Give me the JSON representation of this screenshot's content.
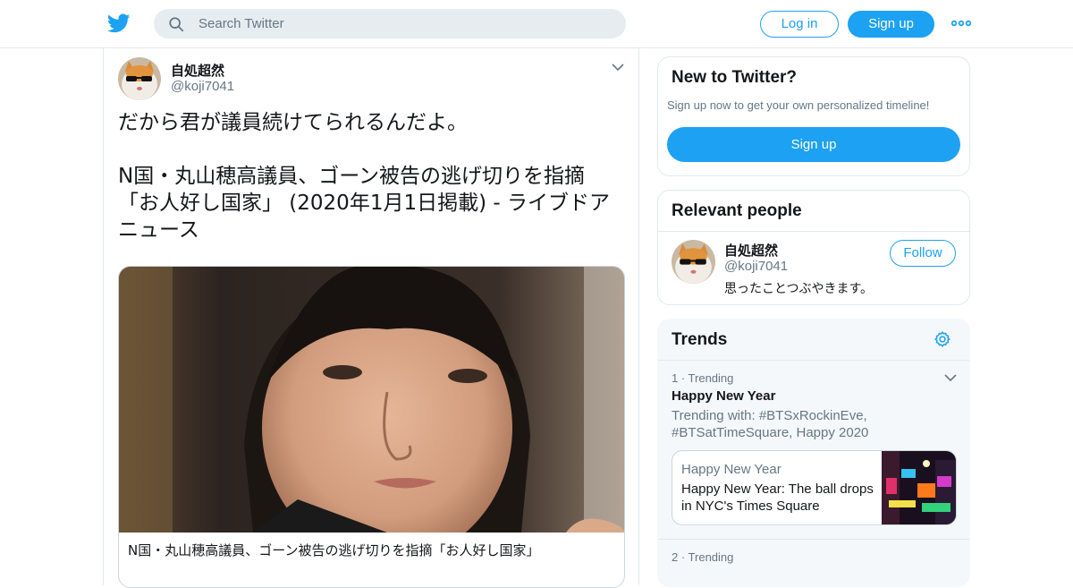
{
  "header": {
    "search_placeholder": "Search Twitter",
    "login_label": "Log in",
    "signup_label": "Sign up",
    "brand_color": "#1da1f2"
  },
  "tweet": {
    "author_name": "自処超然",
    "author_handle": "@koji7041",
    "text_line1": "だから君が議員続けてられるんだよ。",
    "text_line2": "N国・丸山穂高議員、ゴーン被告の逃げ切りを指摘",
    "text_line3": "「お人好し国家」 (2020年1月1日掲載) - ライブドア",
    "text_line4": "ニュース",
    "card": {
      "title": "N国・丸山穂高議員、ゴーン被告の逃げ切りを指摘「お人好し国家」"
    }
  },
  "sidebar": {
    "new_to": {
      "title": "New to Twitter?",
      "subtitle": "Sign up now to get your own personalized timeline!",
      "signup_label": "Sign up"
    },
    "people": {
      "title": "Relevant people",
      "name": "自処超然",
      "handle": "@koji7041",
      "bio": "思ったことつぶやきます。",
      "follow_label": "Follow"
    },
    "trends": {
      "title": "Trends",
      "items": [
        {
          "meta": "1 · Trending",
          "name": "Happy New Year",
          "with": "Trending with: #BTSxRockinEve, #BTSatTimeSquare, Happy 2020",
          "moment_category": "Happy New Year",
          "moment_title": "Happy New Year: The ball drops in NYC's Times Square"
        },
        {
          "meta": "2 · Trending"
        }
      ]
    }
  }
}
